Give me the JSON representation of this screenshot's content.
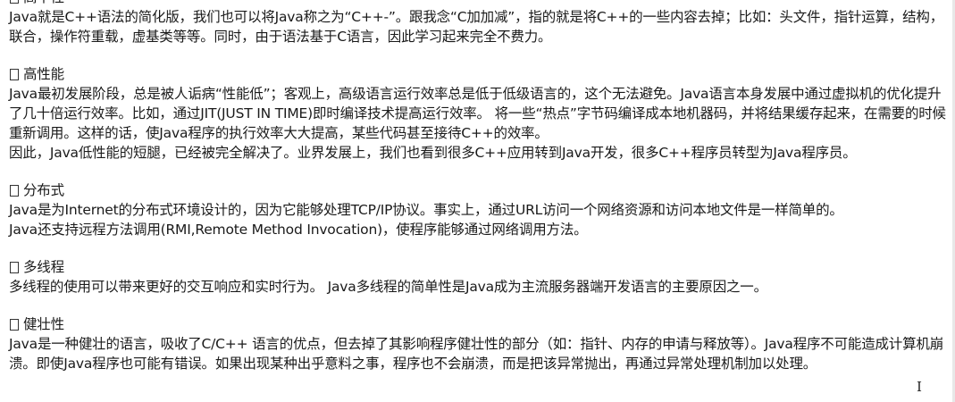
{
  "sections": [
    {
      "heading": "高平性",
      "paragraphs": [
        "Java就是C++语法的简化版，我们也可以将Java称之为“C++-”。跟我念“C加加减”，指的就是将C++的一些内容去掉；比如：头文件，指针运算，结构，联合，操作符重载，虚基类等等。同时，由于语法基于C语言，因此学习起来完全不费力。"
      ]
    },
    {
      "heading": "高性能",
      "paragraphs": [
        "Java最初发展阶段，总是被人诟病“性能低”；客观上，高级语言运行效率总是低于低级语言的，这个无法避免。Java语言本身发展中通过虚拟机的优化提升了几十倍运行效率。比如，通过JIT(JUST IN TIME)即时编译技术提高运行效率。 将一些“热点”字节码编译成本地机器码，并将结果缓存起来，在需要的时候重新调用。这样的话，使Java程序的执行效率大大提高，某些代码甚至接待C++的效率。",
        "因此，Java低性能的短腿，已经被完全解决了。业界发展上，我们也看到很多C++应用转到Java开发，很多C++程序员转型为Java程序员。"
      ]
    },
    {
      "heading": "分布式",
      "paragraphs": [
        "Java是为Internet的分布式环境设计的，因为它能够处理TCP/IP协议。事实上，通过URL访问一个网络资源和访问本地文件是一样简单的。",
        "Java还支持远程方法调用(RMI,Remote Method Invocation)，使程序能够通过网络调用方法。"
      ]
    },
    {
      "heading": "多线程",
      "paragraphs": [
        "多线程的使用可以带来更好的交互响应和实时行为。 Java多线程的简单性是Java成为主流服务器端开发语言的主要原因之一。"
      ]
    },
    {
      "heading": "健壮性",
      "paragraphs": [
        "Java是一种健壮的语言，吸收了C/C++ 语言的优点，但去掉了其影响程序健壮性的部分（如：指针、内存的申请与释放等）。Java程序不可能造成计算机崩溃。即使Java程序也可能有错误。如果出现某种出乎意料之事，程序也不会崩溃，而是把该异常抛出，再通过异常处理机制加以处理。"
      ]
    }
  ],
  "icons": {
    "bullet": "checkbox-square-icon",
    "cursor": "text-cursor-icon"
  }
}
